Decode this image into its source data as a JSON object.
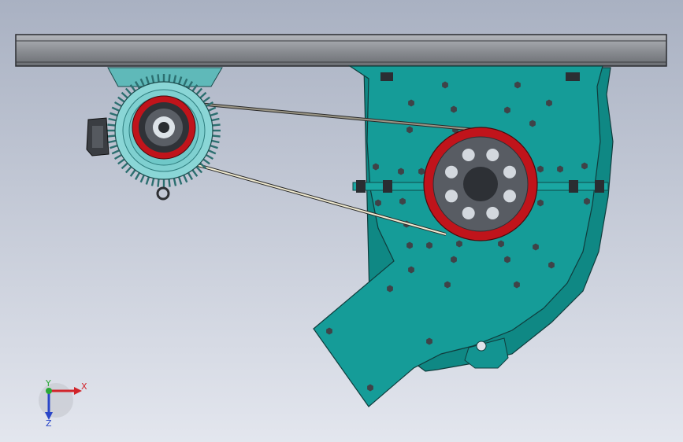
{
  "viewport": {
    "background_top": "#a9b1c2",
    "background_bottom": "#e3e6ee"
  },
  "colors": {
    "housing": "#159c98",
    "housing_dark": "#0d6e6b",
    "motor": "#7fd8d8",
    "motor_dark": "#3c9ea1",
    "pulley_red": "#c0141b",
    "hub_gray": "#585c63",
    "hub_dark": "#2d3035",
    "beam": "#8c8f94",
    "belt": "#e8e2c6",
    "bolt": "#3f4348"
  },
  "triad": {
    "x_label": "X",
    "y_label": "Y",
    "z_label": "Z",
    "x_color": "#d1242a",
    "y_color": "#2aa836",
    "z_color": "#2a46c8"
  }
}
